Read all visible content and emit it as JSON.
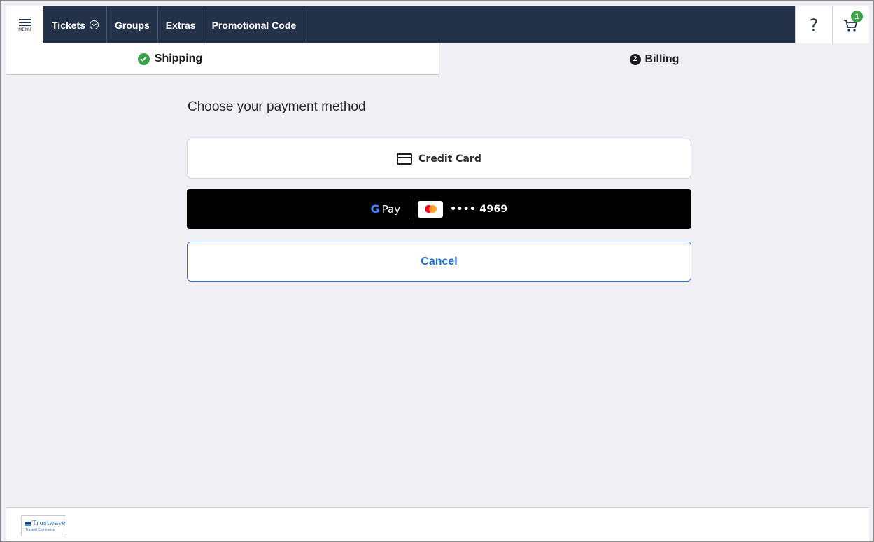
{
  "header": {
    "menu_label": "MENU",
    "nav": [
      {
        "label": "Tickets"
      },
      {
        "label": "Groups"
      },
      {
        "label": "Extras"
      },
      {
        "label": "Promotional Code"
      }
    ],
    "help_glyph": "?",
    "cart_count": "1"
  },
  "steps": {
    "shipping": {
      "label": "Shipping",
      "status": "complete"
    },
    "billing": {
      "number": "2",
      "label": "Billing",
      "status": "active"
    }
  },
  "payment": {
    "title": "Choose your payment method",
    "credit_card_label": "Credit Card",
    "gpay": {
      "g": "G",
      "pay": "Pay",
      "card_mask": "•••• 4969"
    },
    "cancel_label": "Cancel"
  },
  "footer": {
    "badge_name": "Trustwave",
    "badge_sub": "Trusted Commerce"
  },
  "colors": {
    "nav_bg": "#233149",
    "page_bg": "#f0eff4",
    "success": "#3aa34a",
    "link_blue": "#1e6fd1"
  }
}
